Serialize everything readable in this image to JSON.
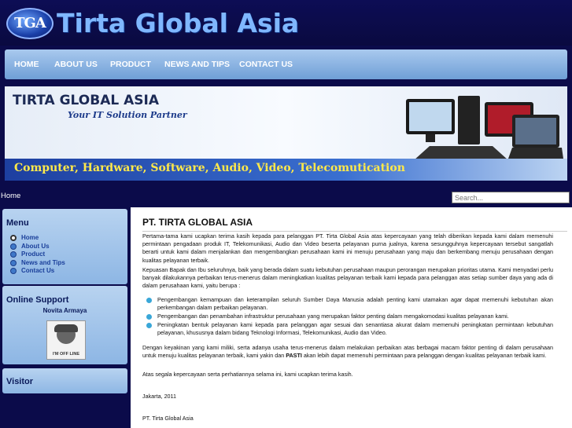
{
  "site": {
    "title": "Tirta Global Asia",
    "logo_text": "TGA"
  },
  "nav": [
    "HOME",
    "ABOUT US",
    "PRODUCT",
    "NEWS AND TIPS",
    "CONTACT US"
  ],
  "banner": {
    "title": "TIRTA GLOBAL ASIA",
    "subtitle": "Your IT Solution Partner",
    "strip": "Computer, Hardware, Software, Audio, Video, Telecomutication"
  },
  "breadcrumb": "Home",
  "search": {
    "placeholder": "Search..."
  },
  "sidebar": {
    "menu_title": "Menu",
    "menu_items": [
      "Home",
      "About Us",
      "Product",
      "News and Tips",
      "Contact Us"
    ],
    "support_title": "Online Support",
    "support_name": "Novita Armaya",
    "support_status": "I'M OFF LINE",
    "visitor_title": "Visitor"
  },
  "content": {
    "heading": "PT. TIRTA GLOBAL ASIA",
    "p1": "Pertama-tama kami ucapkan terima kasih kepada para pelanggan PT. Tirta Global Asia atas kepercayaan yang telah diberikan kepada kami dalam memenuhi permintaan pengadaan produk IT, Telekomunikasi, Audio dan Video beserta pelayanan purna jualnya, karena sesungguhnya kepercayaan tersebut sangatlah berarti untuk kami dalam menjalankan dan mengembangkan perusahaan kami ini menuju perusahaan yang maju dan berkembang menuju perusahaan dengan kualitas pelayanan terbaik.",
    "p2": "Kepuasan Bapak dan Ibu seluruhnya, baik yang berada dalam suatu kebutuhan perusahaan maupun perorangan merupakan prioritas utama. Kami menyadari perlu banyak dilakukannya perbaikan terus-menerus dalam meningkatkan kualitas pelayanan terbaik kami kepada para pelanggan atas setiap sumber daya yang ada di dalam perusahaan kami, yaitu berupa :",
    "bullets": [
      "Pengembangan kemampuan dan keterampilan seluruh Sumber Daya Manusia adalah penting kami utamakan agar dapat memenuhi kebutuhan akan perkembangan dalam perbaikan pelayanan.",
      "Pengembangan dan penambahan infrastruktur perusahaan yang merupakan faktor penting dalam mengakomodasi kualitas pelayanan kami.",
      "Peningkatan bentuk pelayanan kami kepada para pelanggan agar sesuai dan senantiasa akurat dalam memenuhi peningkatan permintaan kebutuhan pelayanan, khususnya dalam bidang Teknologi Informasi, Telekomunikasi, Audio dan Video."
    ],
    "p3a": "Dengan keyakinan yang kami miliki, serta adanya usaha terus-menerus dalam melakukan perbaikan atas berbagai macam faktor penting di dalam perusahaan untuk menuju kualitas pelayanan terbaik, kami yakin dan ",
    "p3b": "PASTI",
    "p3c": " akan lebih dapat memenuhi permintaan para pelanggan dengan kualitas pelayanan terbaik kami.",
    "p4": "Atas segala kepercayaan serta perhatiannya selama ini, kami ucapkan terima kasih.",
    "date": "Jakarta, 2011",
    "signature": "PT. Tirta Global Asia"
  }
}
